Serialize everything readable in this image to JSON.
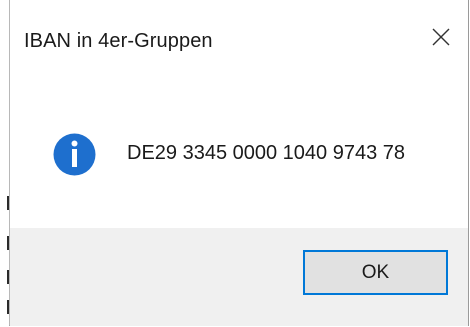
{
  "window": {
    "title": "IBAN in 4er-Gruppen"
  },
  "title_bar": {
    "close_icon": "close-icon"
  },
  "content": {
    "icon": "info-icon",
    "icon_color": "#1e6fce",
    "message": "DE29 3345 0000 1040 9743 78"
  },
  "footer": {
    "ok_label": "OK",
    "button_border_color": "#0078d7"
  }
}
